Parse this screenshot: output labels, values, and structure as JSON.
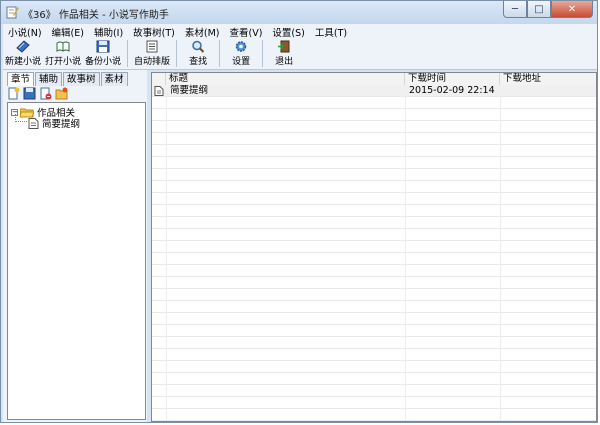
{
  "window": {
    "title": "《36》 作品相关 - 小说写作助手"
  },
  "controls": {
    "minimize": "─",
    "maximize": "□",
    "close": "✕"
  },
  "menu": [
    "小说(N)",
    "编辑(E)",
    "辅助(I)",
    "故事树(T)",
    "素材(M)",
    "查看(V)",
    "设置(S)",
    "工具(T)"
  ],
  "toolbar": {
    "new_novel": "新建小说",
    "open_novel": "打开小说",
    "backup_novel": "备份小说",
    "auto_layout": "自动排版",
    "find": "查找",
    "settings": "设置",
    "exit": "退出"
  },
  "left_tabs": [
    "章节",
    "辅助",
    "故事树",
    "素材"
  ],
  "tree": {
    "root": {
      "label": "作品相关",
      "expander": "⊟"
    },
    "child": {
      "label": "简要提纲"
    }
  },
  "list": {
    "columns": [
      "标题",
      "下载时间",
      "下载地址"
    ],
    "rows": [
      {
        "title": "简要提纲",
        "time": "2015-02-09 22:14",
        "address": ""
      }
    ]
  },
  "colors": {
    "title_gradient": "#c4d7ee",
    "close_red": "#c74b32",
    "panel": "#eef3fa"
  }
}
